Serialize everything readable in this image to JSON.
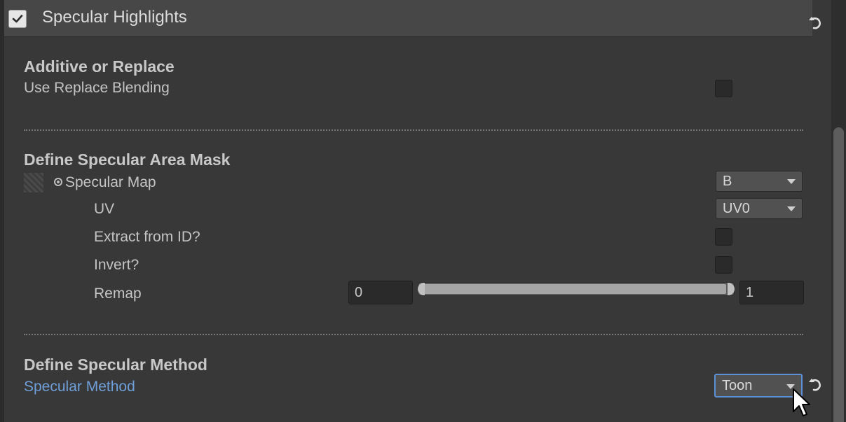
{
  "header": {
    "checked": true,
    "title": "Specular Highlights"
  },
  "sections": {
    "additive": {
      "title": "Additive or Replace",
      "use_replace_label": "Use Replace Blending",
      "use_replace_checked": false
    },
    "mask": {
      "title": "Define Specular Area Mask",
      "specular_map_label": "Specular Map",
      "specular_map_value": "B",
      "uv_label": "UV",
      "uv_value": "UV0",
      "extract_label": "Extract from ID?",
      "extract_checked": false,
      "invert_label": "Invert?",
      "invert_checked": false,
      "remap_label": "Remap",
      "remap_min": "0",
      "remap_max": "1"
    },
    "method": {
      "title": "Define Specular Method",
      "method_label": "Specular Method",
      "method_value": "Toon"
    }
  },
  "icons": {
    "revert": "revert-icon",
    "cursor": "mouse-pointer-icon"
  },
  "colors": {
    "background": "#383838",
    "header": "#474747",
    "modified_label": "#6f9fd8",
    "focus": "#5b8fd6"
  }
}
